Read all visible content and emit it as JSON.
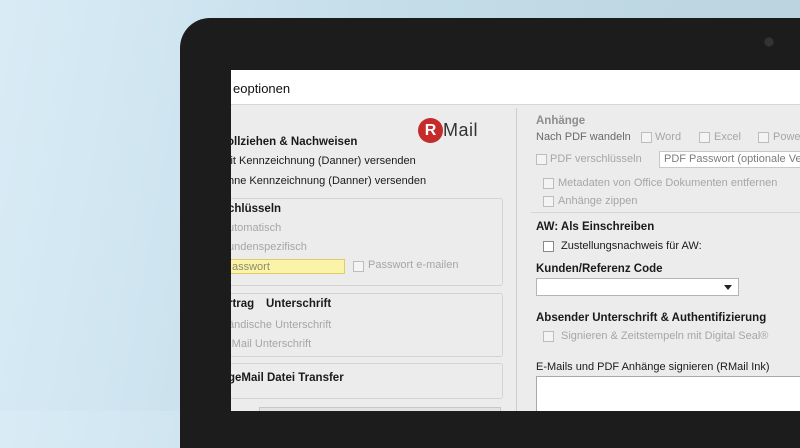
{
  "window": {
    "title": "eoptionen"
  },
  "logo": {
    "letter": "R",
    "text": "Mail",
    "color": "#c62b2b"
  },
  "left": {
    "section1": {
      "title": "ollziehen & Nachweisen",
      "opt1": "lit Kennzeichnung (Danner) versenden",
      "opt2": "hne Kennzeichnung (Danner) versenden"
    },
    "section2": {
      "title": "chlüsseln",
      "opt1": "utomatisch",
      "opt2": "undenspezifisch",
      "password_value": "asswort",
      "email_pw_label": "Passwort e-mailen"
    },
    "section3": {
      "title": "rtrag",
      "title2": "Unterschrift",
      "opt1": "ändische Unterschrift",
      "opt2": "-Mail Unterschrift"
    },
    "section4": {
      "title": "geMail Datei Transfer"
    }
  },
  "right": {
    "attachments": {
      "title": "Anhänge",
      "convert_label": "Nach PDF wandeln",
      "word": "Word",
      "excel": "Excel",
      "power": "Powe",
      "encrypt_pdf": "PDF verschlüsseln",
      "pdf_password": "PDF Passwort (optionale Vers",
      "remove_metadata": "Metadaten von Office Dokumenten entfernen",
      "zip": "Anhänge zippen"
    },
    "registered": {
      "title": "AW: Als Einschreiben",
      "delivery_proof": "Zustellungsnachweis für AW:"
    },
    "customer_code": {
      "title": "Kunden/Referenz Code",
      "value": ""
    },
    "sender_signature": {
      "title": "Absender Unterschrift & Authentifizierung",
      "sign_timestamp": "Signieren & Zeitstempeln mit Digital Seal®"
    },
    "ink": {
      "title": "E-Mails und PDF Anhänge signieren (RMail Ink)"
    }
  }
}
